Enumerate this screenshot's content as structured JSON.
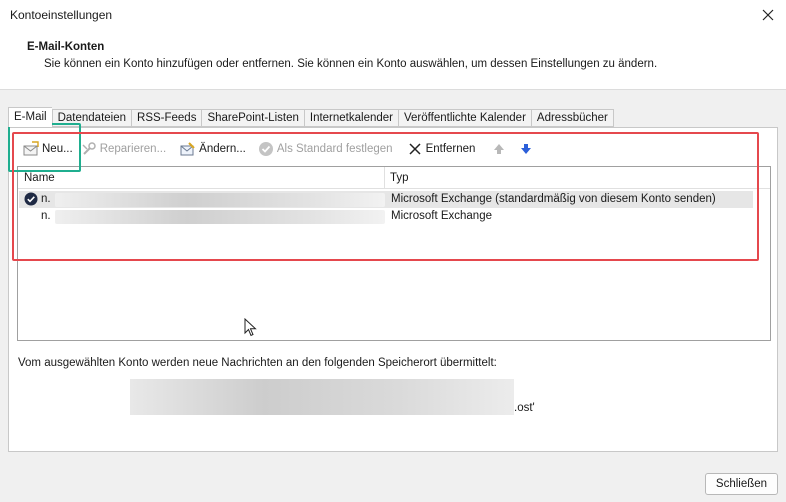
{
  "window": {
    "title": "Kontoeinstellungen"
  },
  "header": {
    "title": "E-Mail-Konten",
    "description": "Sie können ein Konto hinzufügen oder entfernen. Sie können ein Konto auswählen, um dessen Einstellungen zu ändern."
  },
  "tabs": [
    {
      "label": "E-Mail"
    },
    {
      "label": "Datendateien"
    },
    {
      "label": "RSS-Feeds"
    },
    {
      "label": "SharePoint-Listen"
    },
    {
      "label": "Internetkalender"
    },
    {
      "label": "Veröffentlichte Kalender"
    },
    {
      "label": "Adressbücher"
    }
  ],
  "toolbar": {
    "new_label": "Neu...",
    "repair_label": "Reparieren...",
    "change_label": "Ändern...",
    "default_label": "Als Standard festlegen",
    "remove_label": "Entfernen"
  },
  "accounts": {
    "col_name": "Name",
    "col_type": "Typ",
    "rows": [
      {
        "name": "n.",
        "type": "Microsoft Exchange (standardmäßig von diesem Konto senden)"
      },
      {
        "name": "n.",
        "type": "Microsoft Exchange"
      }
    ]
  },
  "info": {
    "text": "Vom ausgewählten Konto werden neue Nachrichten an den folgenden Speicherort übermittelt:",
    "path_suffix": ".ost'"
  },
  "footer": {
    "close_label": "Schließen"
  },
  "colors": {
    "highlight_green": "#1fae8f",
    "highlight_red": "#e5484d",
    "accent_blue": "#2b5fd9"
  }
}
